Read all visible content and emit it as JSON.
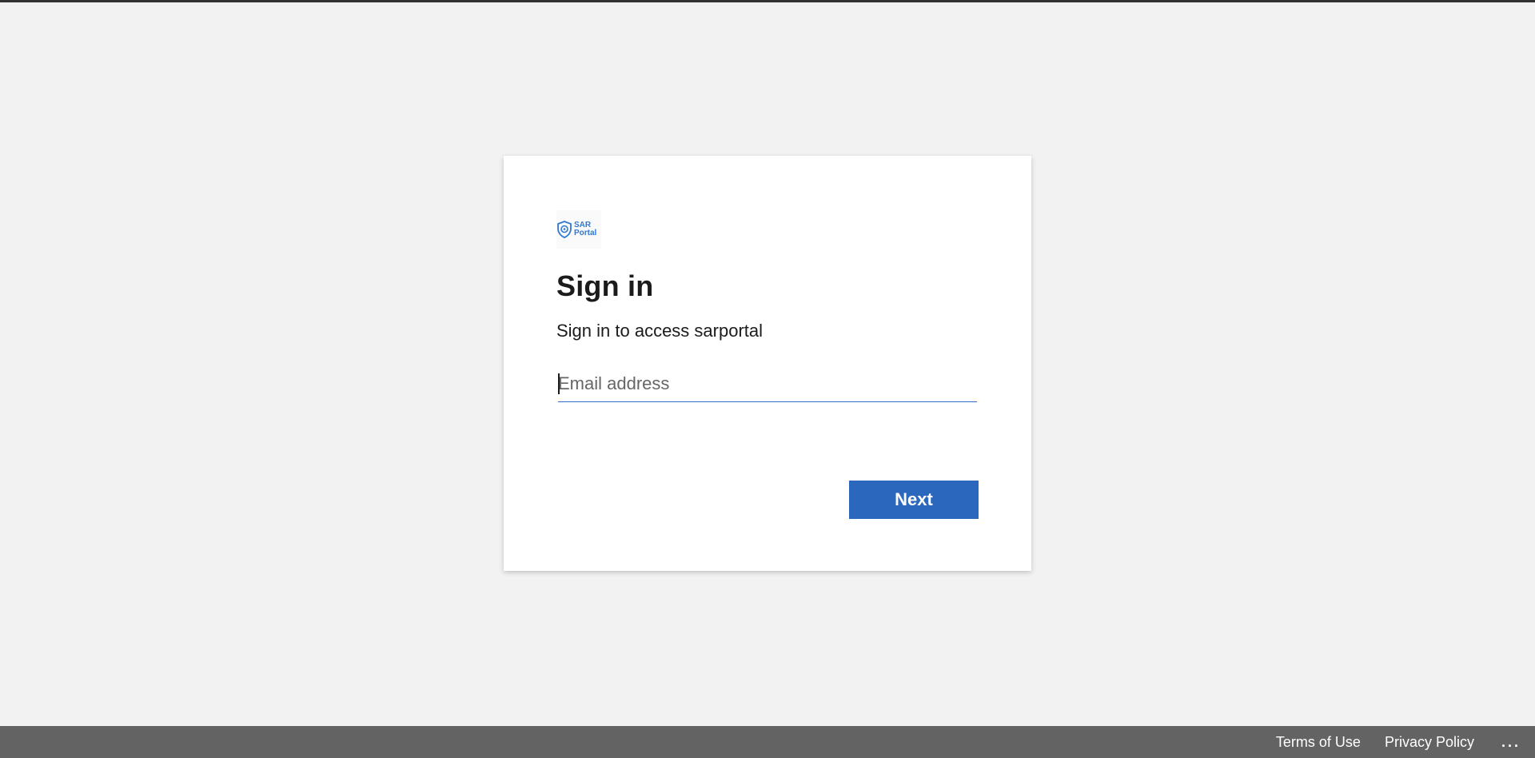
{
  "logo": {
    "line1": "SAR",
    "line2": "Portal",
    "icon": "shield-icon",
    "color": "#2f78d4"
  },
  "signin": {
    "title": "Sign in",
    "subtitle": "Sign in to access sarportal",
    "email_placeholder": "Email address",
    "email_value": "",
    "next_label": "Next"
  },
  "footer": {
    "terms_label": "Terms of Use",
    "privacy_label": "Privacy Policy",
    "more_label": "..."
  },
  "colors": {
    "accent": "#2b67bd",
    "background": "#f2f2f2",
    "footer": "#636363"
  }
}
